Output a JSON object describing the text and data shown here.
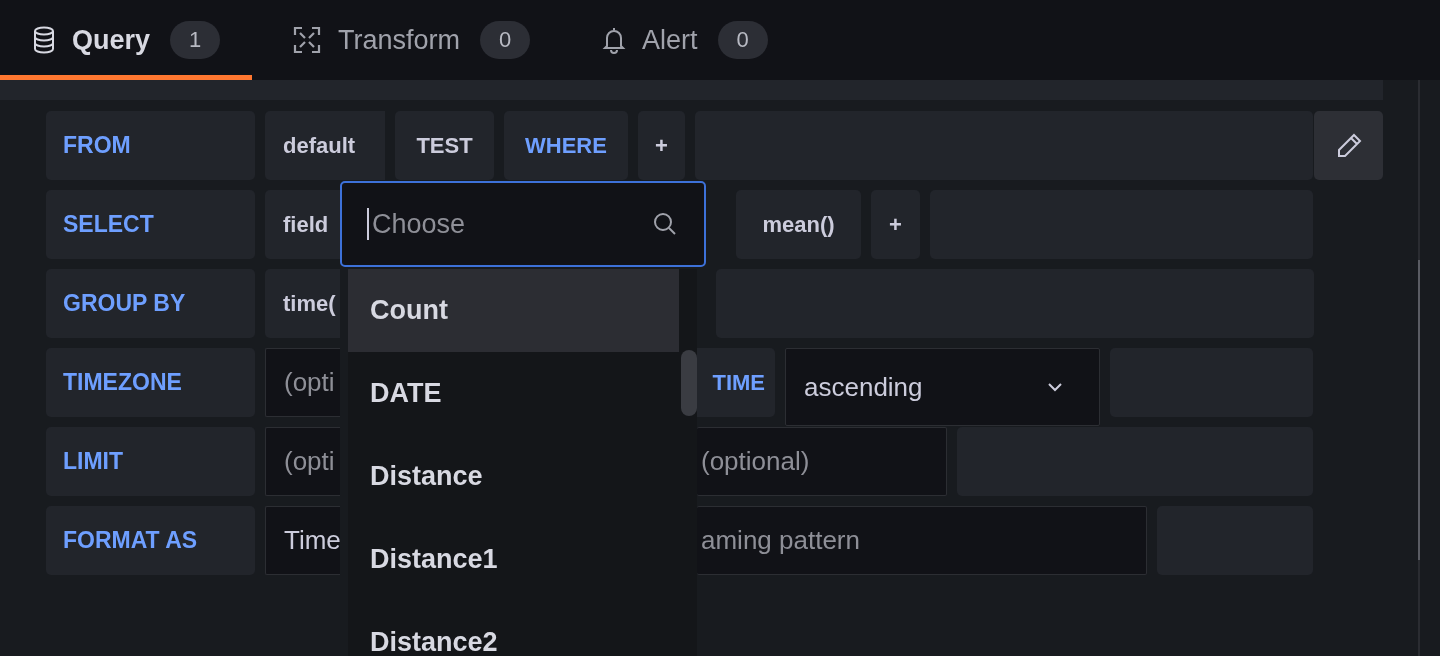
{
  "tabs": [
    {
      "label": "Query",
      "count": "1",
      "selected": true
    },
    {
      "label": "Transform",
      "count": "0",
      "selected": false
    },
    {
      "label": "Alert",
      "count": "0",
      "selected": false
    }
  ],
  "rows": [
    {
      "label": "FROM",
      "segments": [
        {
          "kind": "part",
          "text": "default"
        },
        {
          "kind": "part",
          "text": "TEST"
        },
        {
          "kind": "keyword",
          "text": "WHERE"
        },
        {
          "kind": "add",
          "text": "+"
        },
        {
          "kind": "filler"
        },
        {
          "kind": "edit"
        }
      ]
    },
    {
      "label": "SELECT",
      "segments": [
        {
          "kind": "part",
          "text": "field"
        },
        {
          "kind": "part",
          "text": "mean()"
        },
        {
          "kind": "add",
          "text": "+"
        },
        {
          "kind": "filler"
        }
      ]
    },
    {
      "label": "GROUP BY",
      "segments": [
        {
          "kind": "part",
          "text": "time("
        },
        {
          "kind": "filler"
        }
      ]
    },
    {
      "label": "TIMEZONE",
      "segments": [
        {
          "kind": "input",
          "placeholder": "(opti"
        },
        {
          "kind": "keyword",
          "text": "TIME"
        },
        {
          "kind": "select",
          "text": "ascending"
        },
        {
          "kind": "filler"
        }
      ]
    },
    {
      "label": "LIMIT",
      "segments": [
        {
          "kind": "input",
          "placeholder": "(opti"
        },
        {
          "kind": "input",
          "placeholder": "(optional)"
        },
        {
          "kind": "filler"
        }
      ]
    },
    {
      "label": "FORMAT AS",
      "segments": [
        {
          "kind": "value",
          "text": "Time"
        },
        {
          "kind": "input",
          "placeholder": "aming pattern"
        },
        {
          "kind": "filler"
        }
      ]
    }
  ],
  "dropdown": {
    "placeholder": "Choose",
    "options": [
      {
        "label": "Count",
        "selected": true
      },
      {
        "label": "DATE",
        "selected": false
      },
      {
        "label": "Distance",
        "selected": false
      },
      {
        "label": "Distance1",
        "selected": false
      },
      {
        "label": "Distance2",
        "selected": false
      }
    ]
  }
}
